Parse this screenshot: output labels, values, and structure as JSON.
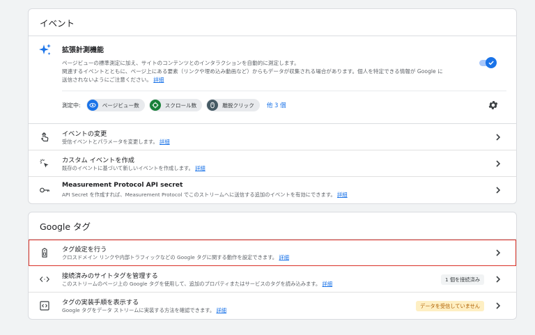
{
  "events_card": {
    "title": "イベント",
    "enhanced": {
      "title": "拡張計測機能",
      "desc_line1": "ページビューの標準測定に加え、サイトのコンテンツとのインタラクションを自動的に測定します。",
      "desc_line2": "関連するイベントとともに、ページ上にある要素（リンクや埋め込み動画など）からもデータが収集される場合があります。個人を特定できる情報が Google に",
      "desc_line3": "送信されないようにご注意ください。",
      "desc_link": "詳細",
      "toggle_on": true,
      "measuring_label": "測定中:",
      "chips": [
        {
          "label": "ページビュー数",
          "icon": "eye-icon",
          "color": "#1a73e8"
        },
        {
          "label": "スクロール数",
          "icon": "crosshair-icon",
          "color": "#188038"
        },
        {
          "label": "離脱クリック",
          "icon": "mouse-icon",
          "color": "#455a64"
        }
      ],
      "more_label": "他 3 個"
    },
    "rows": [
      {
        "title": "イベントの変更",
        "desc": "受信イベントとパラメータを変更します。",
        "link": "詳細",
        "icon": "touch-icon"
      },
      {
        "title": "カスタム イベントを作成",
        "desc": "既存のイベントに基づいて新しいイベントを作成します。",
        "link": "詳細",
        "icon": "click-sparkle-icon"
      },
      {
        "title": "Measurement Protocol API secret",
        "desc": "API Secret を作成すれば、Measurement Protocol でこのストリームへに送信する追加のイベントを有効にできます。",
        "link": "詳細",
        "icon": "key-icon"
      }
    ]
  },
  "google_tag_card": {
    "title": "Google タグ",
    "rows": [
      {
        "title": "タグ設定を行う",
        "desc": "クロスドメイン リンクや内部トラフィックなどの Google タグに関する動作を設定できます。",
        "link": "詳細",
        "icon": "tag-icon"
      },
      {
        "title": "接続済みのサイトタグを管理する",
        "desc": "このストリームのページ上の Google タグを使用して、追加のプロパティまたはサービスのタグを読み込みます。",
        "link": "詳細",
        "icon": "code-icon",
        "badge": "1 個を接続済み"
      },
      {
        "title": "タグの実装手順を表示する",
        "desc": "Google タグをデータ ストリームに実装する方法を確認できます。",
        "link": "詳細",
        "icon": "code-box-icon",
        "badge": "データを受信していません"
      }
    ]
  },
  "colors": {
    "accent": "#1a73e8",
    "highlight": "#d93025",
    "warn_bg": "#feefc3",
    "warn_text": "#b06000"
  }
}
